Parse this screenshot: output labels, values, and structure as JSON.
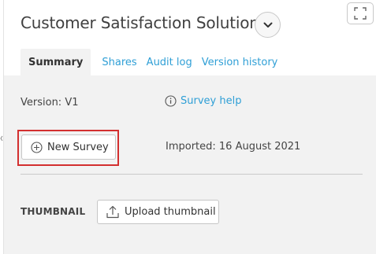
{
  "header": {
    "title": "Customer Satisfaction Solution"
  },
  "tabs": [
    {
      "label": "Summary",
      "active": true
    },
    {
      "label": "Shares",
      "active": false
    },
    {
      "label": "Audit log",
      "active": false
    },
    {
      "label": "Version history",
      "active": false
    }
  ],
  "summary": {
    "version": "Version: V1",
    "help_link": "Survey help",
    "new_survey_button": "New Survey",
    "imported": "Imported: 16 August 2021",
    "thumbnail_label": "THUMBNAIL",
    "upload_button": "Upload thumbnail"
  },
  "colors": {
    "link": "#2f9fd6",
    "highlight": "#d32f2f",
    "body_bg": "#f2f2f2"
  },
  "icons": [
    "chevron-down-icon",
    "expand-icon",
    "info-icon",
    "plus-circle-icon",
    "upload-icon"
  ]
}
